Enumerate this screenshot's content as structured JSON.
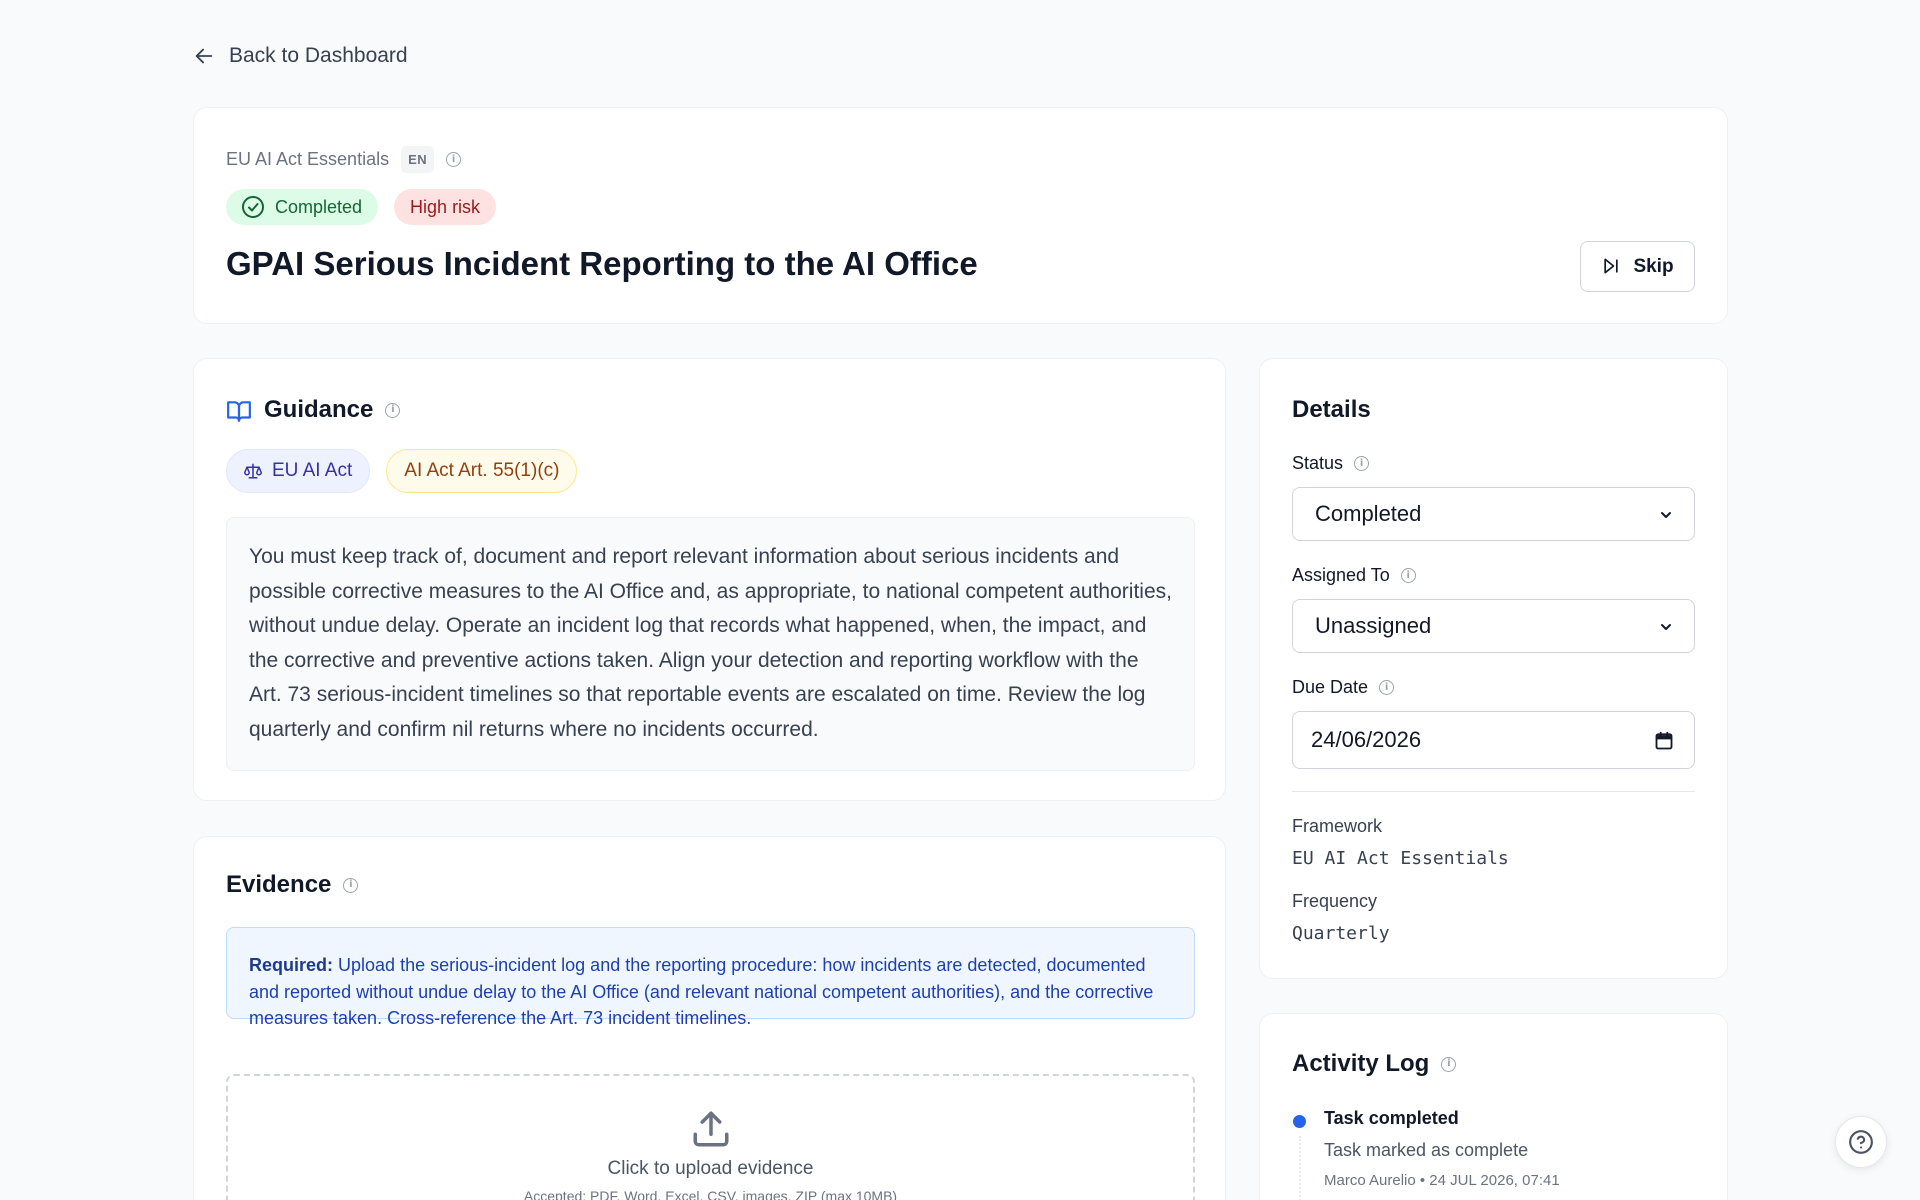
{
  "nav": {
    "back_label": "Back to Dashboard"
  },
  "header": {
    "framework_name": "EU AI Act Essentials",
    "language_badge": "EN",
    "status_pill": "Completed",
    "risk_pill": "High risk",
    "title": "GPAI Serious Incident Reporting to the AI Office",
    "skip_label": "Skip"
  },
  "guidance": {
    "heading": "Guidance",
    "tags": [
      "EU AI Act",
      "AI Act Art. 55(1)(c)"
    ],
    "text": "You must keep track of, document and report relevant information about serious incidents and possible corrective measures to the AI Office and, as appropriate, to national competent authorities, without undue delay. Operate an incident log that records what happened, when, the impact, and the corrective and preventive actions taken. Align your detection and reporting workflow with the Art. 73 serious-incident timelines so that reportable events are escalated on time. Review the log quarterly and confirm nil returns where no incidents occurred."
  },
  "evidence": {
    "heading": "Evidence",
    "required_label": "Required:",
    "required_text": "Upload the serious-incident log and the reporting procedure: how incidents are detected, documented and reported without undue delay to the AI Office (and relevant national competent authorities), and the corrective measures taken. Cross-reference the Art. 73 incident timelines.",
    "upload_label": "Click to upload evidence",
    "upload_note": "Accepted: PDF, Word, Excel, CSV, images, ZIP (max 10MB)"
  },
  "details": {
    "heading": "Details",
    "status_label": "Status",
    "status_value": "Completed",
    "assigned_label": "Assigned To",
    "assigned_value": "Unassigned",
    "due_label": "Due Date",
    "due_value": "24/06/2026",
    "framework_label": "Framework",
    "framework_value": "EU AI Act Essentials",
    "frequency_label": "Frequency",
    "frequency_value": "Quarterly"
  },
  "activity": {
    "heading": "Activity Log",
    "items": [
      {
        "title": "Task completed",
        "description": "Task marked as complete",
        "meta": "Marco Aurelio • 24 JUL 2026, 07:41"
      }
    ]
  },
  "colors": {
    "accent": "#2563eb",
    "completed_bg": "#dcfce7",
    "completed_text": "#166534",
    "risk_bg": "#fee2e2",
    "risk_text": "#991b1b"
  },
  "icons": {
    "back": "arrow-left-icon",
    "info": "info-icon",
    "completed": "check-circle-icon",
    "skip": "skip-forward-icon",
    "guidance": "book-open-icon",
    "framework_tag": "scale-icon",
    "upload": "upload-icon",
    "calendar": "calendar-icon",
    "help": "help-circle-icon"
  }
}
